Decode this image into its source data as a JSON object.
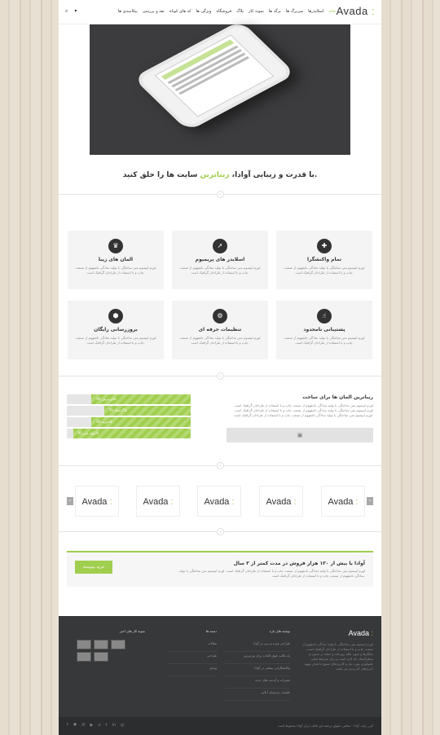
{
  "logo": {
    "text": "Avada",
    "accent": ":"
  },
  "nav": [
    "خانه",
    "اسلایدرها",
    "سربرگ ها",
    "برگه ها",
    "نمونه کار",
    "بلاگ",
    "فروشگاه",
    "ویژگی ها",
    "کد های کوتاه",
    "نقد و بررسی",
    "پیکانبندی ها"
  ],
  "header_icons": {
    "search": "⌕",
    "cart": "▾"
  },
  "tagline": {
    "a": "با قدرت و زیبایی آوادا، ",
    "b": "زیباترین",
    "c": " سایت ها را خلق کنید."
  },
  "features": [
    {
      "title": "تمام واکنشگرا",
      "desc": "لورم ایپسوم متن ساختگی با تولید سادگی نامفهوم از صنعت چاپ و با استفاده از طراحان گرافیک است.",
      "icon": "✚"
    },
    {
      "title": "اسلایدر های پریمیوم",
      "desc": "لورم ایپسوم متن ساختگی با تولید سادگی نامفهوم از صنعت چاپ و با استفاده از طراحان گرافیک است.",
      "icon": "➚"
    },
    {
      "title": "المان های زیبا",
      "desc": "لورم ایپسوم متن ساختگی با تولید سادگی نامفهوم از صنعت چاپ و با استفاده از طراحان گرافیک است.",
      "icon": "♛"
    },
    {
      "title": "پشتیبانی نامحدود",
      "desc": "لورم ایپسوم متن ساختگی با تولید سادگی نامفهوم از صنعت چاپ و با استفاده از طراحان گرافیک است.",
      "icon": "☝"
    },
    {
      "title": "تنظیمات حرفه ای",
      "desc": "لورم ایپسوم متن ساختگی با تولید سادگی نامفهوم از صنعت چاپ و با استفاده از طراحان گرافیک است.",
      "icon": "⚙"
    },
    {
      "title": "بروزرسانی رایگان",
      "desc": "لورم ایپسوم متن ساختگی با تولید سادگی نامفهوم از صنعت چاپ و با استفاده از طراحان گرافیک است.",
      "icon": "⬢"
    }
  ],
  "skills": [
    {
      "label": "وردپرس 80%",
      "value": 80
    },
    {
      "label": "گرافیک 70%",
      "value": 70
    },
    {
      "label": "تجربه 80%",
      "value": 80
    },
    {
      "label": "تولید متن 95%",
      "value": 95
    }
  ],
  "about": {
    "heading": "زیباترین المان ها برای ساخت",
    "text": "لورم ایپسوم متن ساختگی با تولید سادگی نامفهوم از صنعت چاپ و با استفاده از طراحان گرافیک است. لورم ایپسوم متن ساختگی با تولید سادگی نامفهوم از صنعت چاپ و با استفاده از طراحان گرافیک است. لورم ایپسوم متن ساختگی با تولید سادگی نامفهوم از صنعت چاپ و با استفاده از طراحان گرافیک است.",
    "button_icon": "▣"
  },
  "clients": {
    "prev": "‹",
    "next": "›",
    "count": 5
  },
  "promo": {
    "heading": "آوادا با بیش از ۱۳۰ هزار فروش در مدت کمتر از ۳ سال",
    "text": "لورم ایپسوم متن ساختگی با تولید سادگی نامفهوم از صنعت چاپ و با استفاده از طراحان گرافیک است. لورم ایپسوم متن ساختگی با تولید سادگی نامفهوم از صنعت چاپ و با استفاده از طراحان گرافیک است.",
    "button": "خرید بپیوسته"
  },
  "footer": {
    "about_text": "لورم ایپسوم متن ساختگی با تولید سادگی نامفهوم از صنعت چاپ و با استفاده از طراحان گرافیک است. چاپگرها و متون بلکه روزنامه و مجله در ستون و سطرآنچنان که لازم است و برای شرایط فعلی تکنولوژی مورد نیاز و کاربردهای متنوع با هدف بهبود ابزارهای کاربردی می باشد.",
    "col2": {
      "heading": "نوشته های تازه",
      "items": [
        "طراحی ویژه و برتر در آوادا",
        "یک قالب فوق العاده برای وردپرس",
        "واکنشگرایی بیشتر در آوادا",
        "تغییرات و آپدیت های جدید",
        "طبیعت مرسینار آنلاین"
      ]
    },
    "col3": {
      "heading": "دسته ها",
      "items": [
        "مقالات",
        "طراحی",
        "ویدئو"
      ]
    },
    "col4": {
      "heading": "نمونه کار های اخیر"
    },
    "copyright": "کپی رایت آوادا - تمامی حقوق ترجمه این قالب برای آوادا محفوظ است",
    "social": [
      "f",
      "♥",
      "✉",
      "▶",
      "⌂",
      "t",
      "in",
      "◎"
    ]
  }
}
